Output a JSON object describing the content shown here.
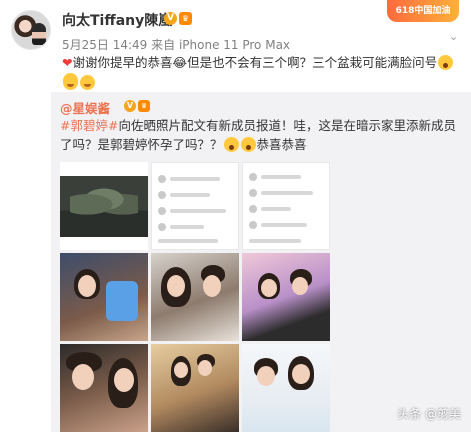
{
  "post": {
    "username": "向太Tiffany陳嵐",
    "verified_badge": "V",
    "level_badge": "♛",
    "timestamp": "5月25日 14:49",
    "source": "来自 iPhone 11 Pro Max",
    "text": "谢谢你提早的恭喜😂但是也不会有三个啊？三个盆栽可能满脸问号",
    "promo_label": "618中国加油"
  },
  "repost": {
    "username": "@星娱酱",
    "hashtag": "#郭碧婷#",
    "text": "向佐晒照片配文有新成员报道！哇，这是在暗示家里添新成员了吗？是郭碧婷怀孕了吗？？",
    "closing": "恭喜恭喜"
  },
  "grid": {
    "images": [
      "photo-1",
      "photo-2",
      "photo-3",
      "photo-4",
      "photo-5",
      "photo-6",
      "photo-7",
      "photo-8",
      "photo-9"
    ]
  },
  "watermark": "头条 @剪美",
  "colors": {
    "accent": "#eb7350",
    "repost_bg": "#f2f2f5",
    "meta": "#808080"
  }
}
